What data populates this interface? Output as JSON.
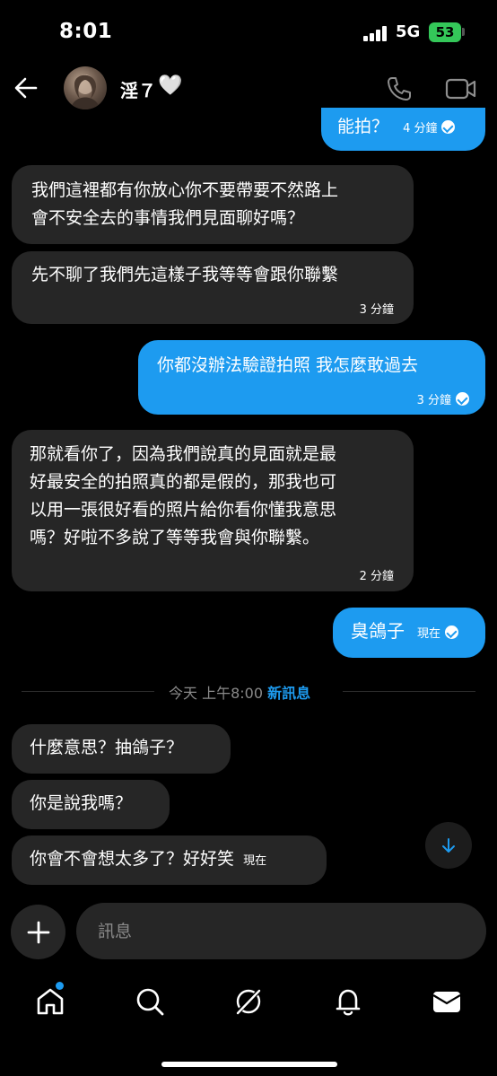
{
  "status_bar": {
    "time": "8:01",
    "network": "5G",
    "battery": "53"
  },
  "header": {
    "contact_name": "淫７",
    "heart": "🤍"
  },
  "messages": [
    {
      "dir": "out",
      "text": "能拍？",
      "time": "4 分鐘"
    },
    {
      "dir": "in",
      "lines": [
        "我們這裡都有你放心你不要帶要不然路上",
        "會不安全去的事情我們見面聊好嗎？"
      ]
    },
    {
      "dir": "in",
      "lines": [
        "先不聊了我們先這樣子我等等會跟你聯繫"
      ],
      "time": "3 分鐘"
    },
    {
      "dir": "out",
      "text": "你都沒辦法驗證拍照 我怎麼敢過去",
      "time": "3 分鐘"
    },
    {
      "dir": "in",
      "lines": [
        "那就看你了，因為我們說真的見面就是最",
        "好最安全的拍照真的都是假的，那我也可",
        "以用一張很好看的照片給你看你懂我意思",
        "嗎？好啦不多說了等等我會與你聯繫。"
      ],
      "time": "2 分鐘"
    },
    {
      "dir": "out",
      "text": "臭鴿子",
      "time": "現在"
    },
    {
      "dir": "in",
      "text": "什麼意思？抽鴿子？"
    },
    {
      "dir": "in",
      "text": "你是說我嗎？"
    },
    {
      "dir": "in",
      "text": "你會不會想太多了？好好笑",
      "time": "現在"
    }
  ],
  "divider": {
    "time": "今天 上午8:00",
    "label": "新訊息"
  },
  "composer": {
    "placeholder": "訊息"
  },
  "colors": {
    "accent": "#1d9bf0",
    "incoming_bubble": "#262626",
    "background": "#000000"
  },
  "icons": [
    "back-arrow-icon",
    "phone-icon",
    "video-icon",
    "arrow-down-icon",
    "plus-icon",
    "home-icon",
    "search-icon",
    "grok-icon",
    "bell-icon",
    "mail-icon"
  ]
}
